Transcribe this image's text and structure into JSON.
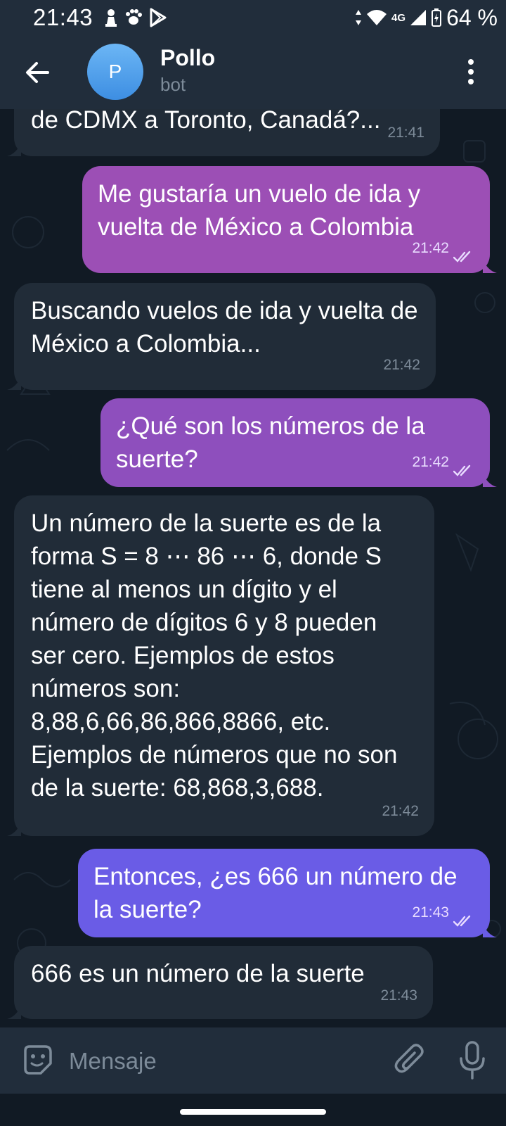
{
  "status_bar": {
    "time": "21:43",
    "network": "4G",
    "battery": "64 %"
  },
  "header": {
    "avatar_letter": "P",
    "name": "Pollo",
    "subtitle": "bot"
  },
  "messages": [
    {
      "direction": "in",
      "text": "de CDMX a Toronto, Canadá?...",
      "time": "21:41"
    },
    {
      "direction": "out",
      "text": "Me gustaría un vuelo de ida y vuelta de México a Colombia",
      "time": "21:42",
      "read": true
    },
    {
      "direction": "in",
      "text": "Buscando vuelos de ida y vuelta de México a Colombia...",
      "time": "21:42"
    },
    {
      "direction": "out",
      "text": "¿Qué son los números de la suerte?",
      "time": "21:42",
      "read": true
    },
    {
      "direction": "in",
      "text": "Un número de la suerte es de la forma S = 8 ⋯ 86 ⋯ 6, donde S tiene al menos un dígito y el número de dígitos 6 y 8 pueden ser cero. Ejemplos de estos números son: 8,88,6,66,86,866,8866, etc. Ejemplos de números que no son de la suerte: 68,868,3,688.",
      "time": "21:42"
    },
    {
      "direction": "out",
      "text": "Entonces, ¿es 666 un número de la suerte?",
      "time": "21:43",
      "read": true
    },
    {
      "direction": "in",
      "text": "666 es un número de la suerte",
      "time": "21:43"
    }
  ],
  "composer": {
    "placeholder": "Mensaje"
  },
  "colors": {
    "incoming_bubble": "#212c38",
    "outgoing_top": "#9c4fb5",
    "outgoing_bottom": "#6a5ce6",
    "header": "#212d3b",
    "background": "#111a24"
  }
}
